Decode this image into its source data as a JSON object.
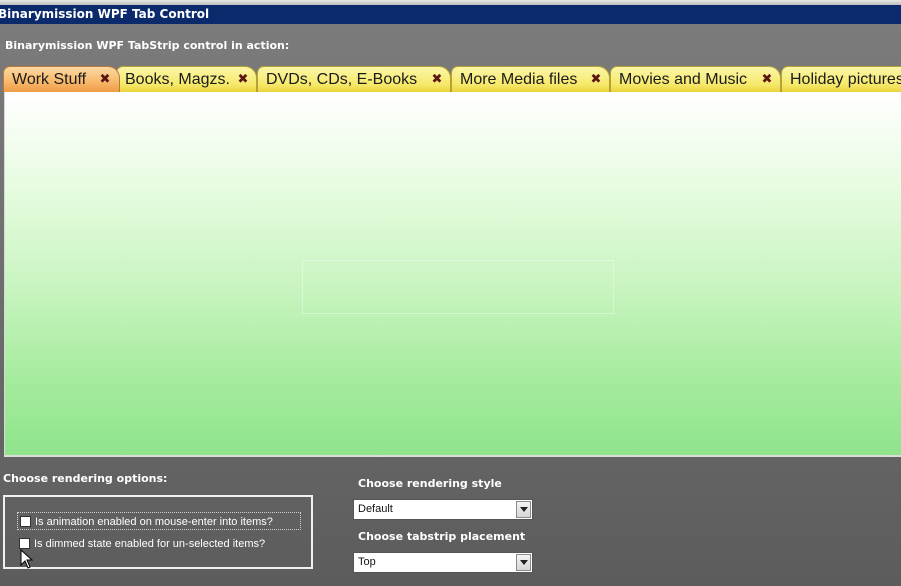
{
  "window": {
    "title": "Binarymission WPF Tab Control"
  },
  "heading": "Binarymission WPF TabStrip control in action:",
  "tabs": [
    {
      "label": "Work Stuff",
      "close_icon": "close-icon",
      "selected": true
    },
    {
      "label": "Books, Magzs.",
      "close_icon": "close-icon",
      "selected": false
    },
    {
      "label": "DVDs, CDs, E-Books",
      "close_icon": "close-icon",
      "selected": false
    },
    {
      "label": "More Media files",
      "close_icon": "close-icon",
      "selected": false
    },
    {
      "label": "Movies and Music",
      "close_icon": "close-icon",
      "selected": false
    },
    {
      "label": "Holiday pictures",
      "close_icon": "close-icon",
      "selected": false
    }
  ],
  "options": {
    "label": "Choose rendering options:",
    "checkboxes": [
      {
        "label": "Is animation enabled on mouse-enter into items?",
        "checked": false
      },
      {
        "label": "Is dimmed state enabled for un-selected items?",
        "checked": false
      }
    ]
  },
  "rendering_style": {
    "label": "Choose rendering style",
    "selected": "Default"
  },
  "placement": {
    "label": "Choose tabstrip placement",
    "selected": "Top"
  },
  "colors": {
    "title_bar": "#0b2a6b",
    "tab_selected": "#f7b86a",
    "tab_normal": "#f6e96a",
    "content_top": "#ffffff",
    "content_bottom": "#8fe48c"
  }
}
